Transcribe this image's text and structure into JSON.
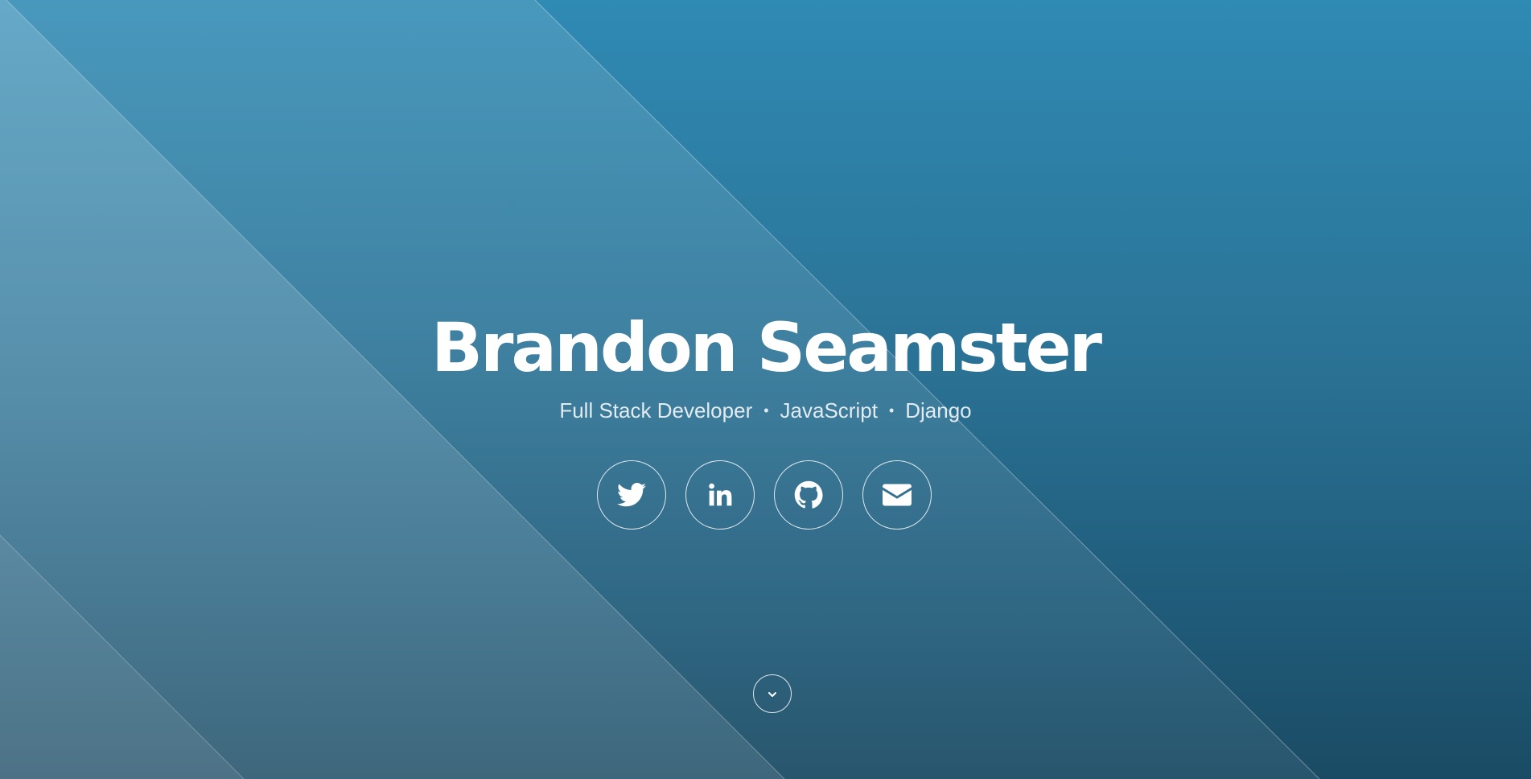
{
  "hero": {
    "name": "Brandon Seamster",
    "tagline": {
      "items": [
        "Full Stack Developer",
        "JavaScript",
        "Django"
      ],
      "separator": "•"
    }
  },
  "social_links": [
    {
      "name": "twitter",
      "icon": "twitter-icon"
    },
    {
      "name": "linkedin",
      "icon": "linkedin-icon"
    },
    {
      "name": "github",
      "icon": "github-icon"
    },
    {
      "name": "email",
      "icon": "envelope-icon"
    }
  ],
  "scroll_button": {
    "icon": "chevron-down-icon"
  },
  "colors": {
    "background_top": "#2f8ab4",
    "background_bottom": "#1b4b64",
    "text": "#ffffff"
  }
}
